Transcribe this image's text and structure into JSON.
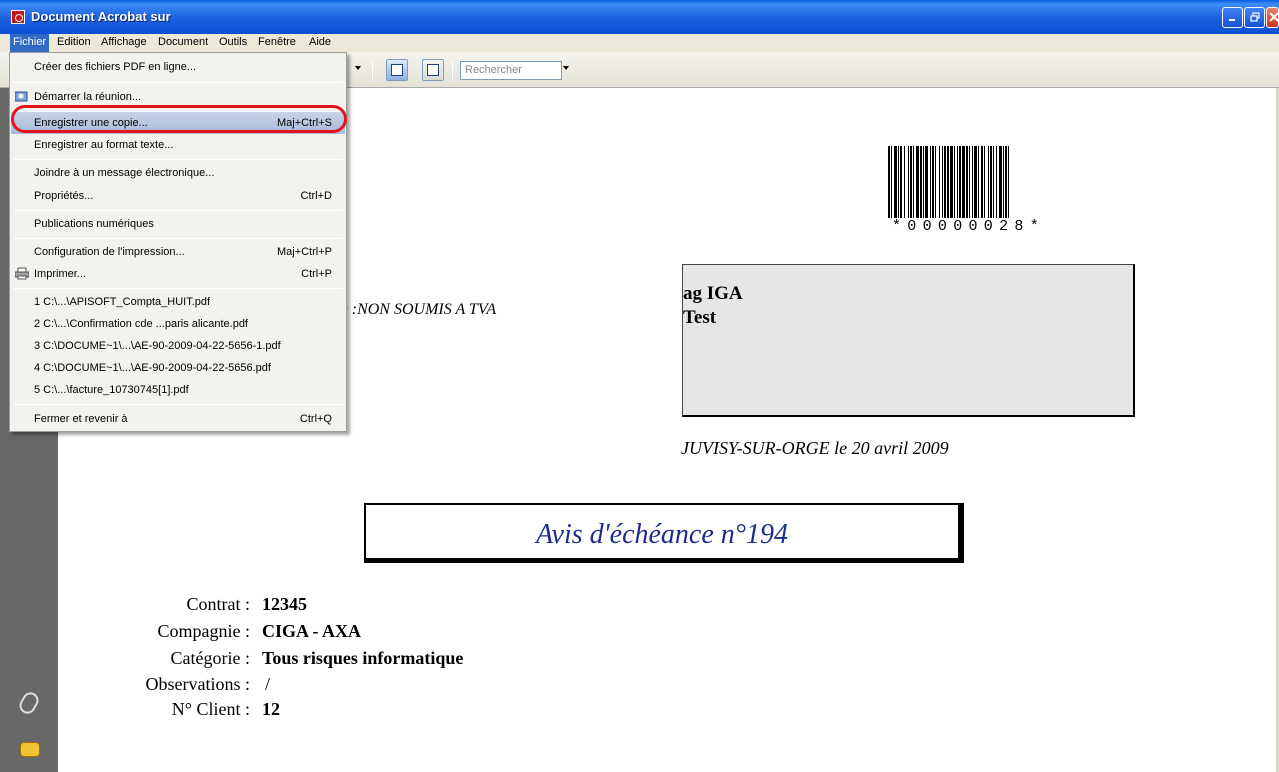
{
  "window": {
    "title": "Document Acrobat sur"
  },
  "menubar": {
    "items": [
      "Fichier",
      "Edition",
      "Affichage",
      "Document",
      "Outils",
      "Fenêtre",
      "Aide"
    ]
  },
  "toolbar": {
    "search_placeholder": "Rechercher"
  },
  "file_menu": {
    "items": [
      {
        "label": "Créer des fichiers PDF en ligne...",
        "shortcut": ""
      },
      {
        "label": "Démarrer la réunion...",
        "shortcut": ""
      },
      {
        "label": "Enregistrer une copie...",
        "shortcut": "Maj+Ctrl+S"
      },
      {
        "label": "Enregistrer au format texte...",
        "shortcut": ""
      },
      {
        "label": "Joindre à un message électronique...",
        "shortcut": ""
      },
      {
        "label": "Propriétés...",
        "shortcut": "Ctrl+D"
      },
      {
        "label": "Publications numériques",
        "shortcut": ""
      },
      {
        "label": "Configuration de l'impression...",
        "shortcut": "Maj+Ctrl+P"
      },
      {
        "label": "Imprimer...",
        "shortcut": "Ctrl+P"
      },
      {
        "label": "1 C:\\...\\APISOFT_Compta_HUIT.pdf",
        "shortcut": ""
      },
      {
        "label": "2 C:\\...\\Confirmation cde ...paris alicante.pdf",
        "shortcut": ""
      },
      {
        "label": "3 C:\\DOCUME~1\\...\\AE-90-2009-04-22-5656-1.pdf",
        "shortcut": ""
      },
      {
        "label": "4 C:\\DOCUME~1\\...\\AE-90-2009-04-22-5656.pdf",
        "shortcut": ""
      },
      {
        "label": "5 C:\\...\\facture_10730745[1].pdf",
        "shortcut": ""
      },
      {
        "label": "Fermer et revenir à",
        "shortcut": "Ctrl+Q"
      }
    ]
  },
  "document": {
    "barcode_text": "*00000028*",
    "address_line1": "ag IGA",
    "address_line2": "Test",
    "tva_text": "re :NON SOUMIS A TVA",
    "date_line": "JUVISY-SUR-ORGE le 20 avril 2009",
    "avis_title": "Avis d'échéance n°194",
    "fields": [
      {
        "label": "Contrat :",
        "value": "12345"
      },
      {
        "label": "Compagnie :",
        "value": "CIGA - AXA"
      },
      {
        "label": "Catégorie :",
        "value": "Tous risques informatique"
      },
      {
        "label": "Observations :",
        "value": "/"
      },
      {
        "label": "N° Client :",
        "value": "12"
      }
    ]
  },
  "colors": {
    "title_bar": "#1d63e0",
    "menu_highlight": "#316ac5",
    "annotation_circle": "#e4141e",
    "avis_title": "#1b2d8c",
    "nav_panel": "#686868"
  }
}
